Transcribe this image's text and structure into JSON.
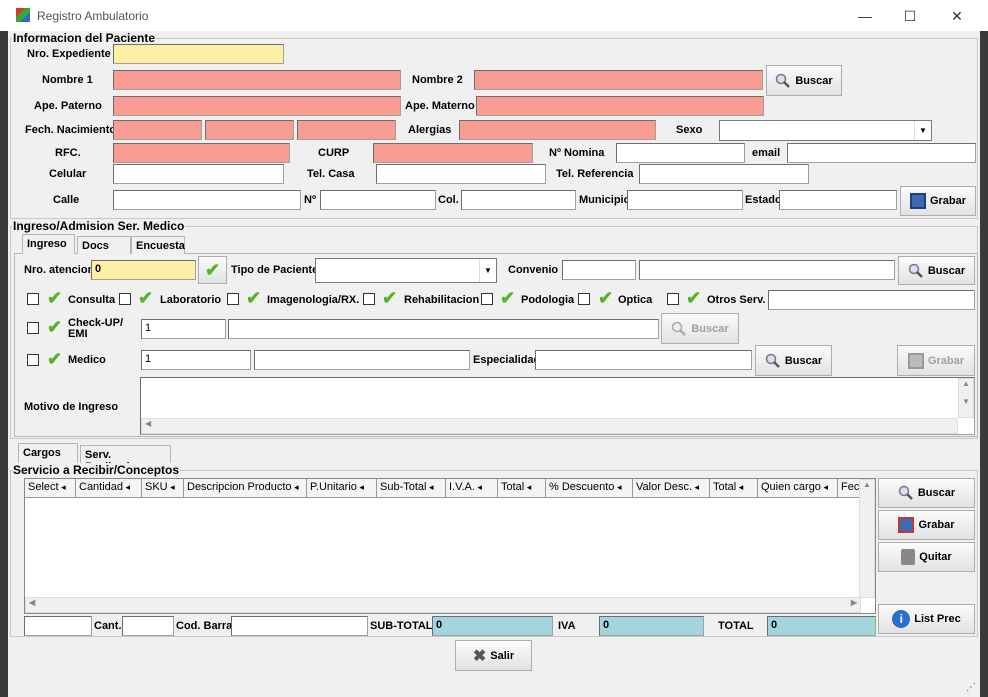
{
  "window": {
    "title": "Registro Ambulatorio",
    "min": "—",
    "max": "☐",
    "close": "✕"
  },
  "paciente": {
    "title": "Informacion del Paciente",
    "expediente": "Nro. Expediente",
    "nombre1": "Nombre 1",
    "nombre2": "Nombre 2",
    "buscar": "Buscar",
    "ape_paterno": "Ape. Paterno",
    "ape_materno": "Ape. Materno",
    "fech_nac": "Fech. Nacimiento",
    "alergias": "Alergias",
    "sexo": "Sexo",
    "rfc": "RFC.",
    "curp": "CURP",
    "nomina": "Nº Nomina",
    "email": "email",
    "celular": "Celular",
    "tel_casa": "Tel. Casa",
    "tel_ref": "Tel. Referencia",
    "calle": "Calle",
    "num": "Nº",
    "col": "Col.",
    "municipio": "Municipio",
    "estado": "Estado",
    "grabar": "Grabar"
  },
  "ingreso": {
    "title": "Ingreso/Admision Ser. Medico",
    "tabs": [
      "Ingreso",
      "Docs",
      "Encuesta"
    ],
    "nro_atencion": "Nro. atencion",
    "nro_atencion_value": "0",
    "tipo_paciente": "Tipo de Paciente",
    "convenio": "Convenio",
    "buscar": "Buscar",
    "servicios": [
      "Consulta",
      "Laboratorio",
      "Imagenologia/RX.",
      "Rehabilitacion",
      "Podologia",
      "Optica",
      "Otros Serv."
    ],
    "checkup": "Check-UP/ EMI",
    "checkup_value": "1",
    "medico": "Medico",
    "medico_value": "1",
    "especialidad": "Especialidad",
    "grabar": "Grabar",
    "motivo": "Motivo de Ingreso"
  },
  "cargos": {
    "tabs": [
      "Cargos",
      "Serv. Realizados"
    ],
    "title": "Servicio a Recibir/Conceptos",
    "columns": [
      "Select",
      "Cantidad",
      "SKU",
      "Descripcion Producto",
      "P.Unitario",
      "Sub-Total",
      "I.V.A.",
      "Total",
      "% Descuento",
      "Valor Desc.",
      "Total",
      "Quien cargo",
      "Fec"
    ],
    "buscar": "Buscar",
    "grabar": "Grabar",
    "quitar": "Quitar",
    "list_prec": "List Prec",
    "cant": "Cant.",
    "cod_barra": "Cod. Barra",
    "subtotal": "SUB-TOTAL",
    "subtotal_value": "0",
    "iva": "IVA",
    "iva_value": "0",
    "total": "TOTAL",
    "total_value": "0"
  },
  "salir": "Salir",
  "colors": {
    "required": "#f89c94",
    "key": "#fdefa4",
    "totals": "#a3d6dc",
    "check": "#58b32c"
  }
}
